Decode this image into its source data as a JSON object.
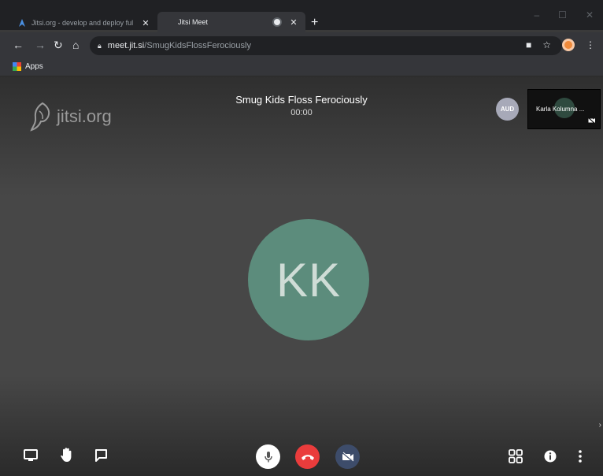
{
  "browser": {
    "tabs": [
      {
        "title": "Jitsi.org - develop and deploy ful",
        "close": "✕"
      },
      {
        "title": "Jitsi Meet",
        "close": "✕"
      }
    ],
    "new_tab": "+",
    "address": {
      "host": "meet.jit.si",
      "path": "/SmugKidsFlossFerociously"
    },
    "bookmarks": {
      "apps": "Apps"
    }
  },
  "meeting": {
    "logo_text": "jitsi.org",
    "room_title": "Smug Kids Floss Ferociously",
    "timer": "00:00",
    "audio_badge": "AUD",
    "local_thumbnail": {
      "name": "Karla Kolumna ..."
    },
    "main_avatar_initials": "KK"
  },
  "colors": {
    "avatar": "#5c8c7c",
    "hangup": "#ea3c3c",
    "camera_off": "#3d4c6a",
    "audio_badge": "#a7a9b8"
  },
  "toolbar_icons": {
    "left": [
      "screen-share-icon",
      "raise-hand-icon",
      "chat-icon"
    ],
    "center": [
      "microphone-icon",
      "hangup-icon",
      "camera-off-icon"
    ],
    "right": [
      "tile-view-icon",
      "info-icon",
      "more-options-icon"
    ]
  }
}
